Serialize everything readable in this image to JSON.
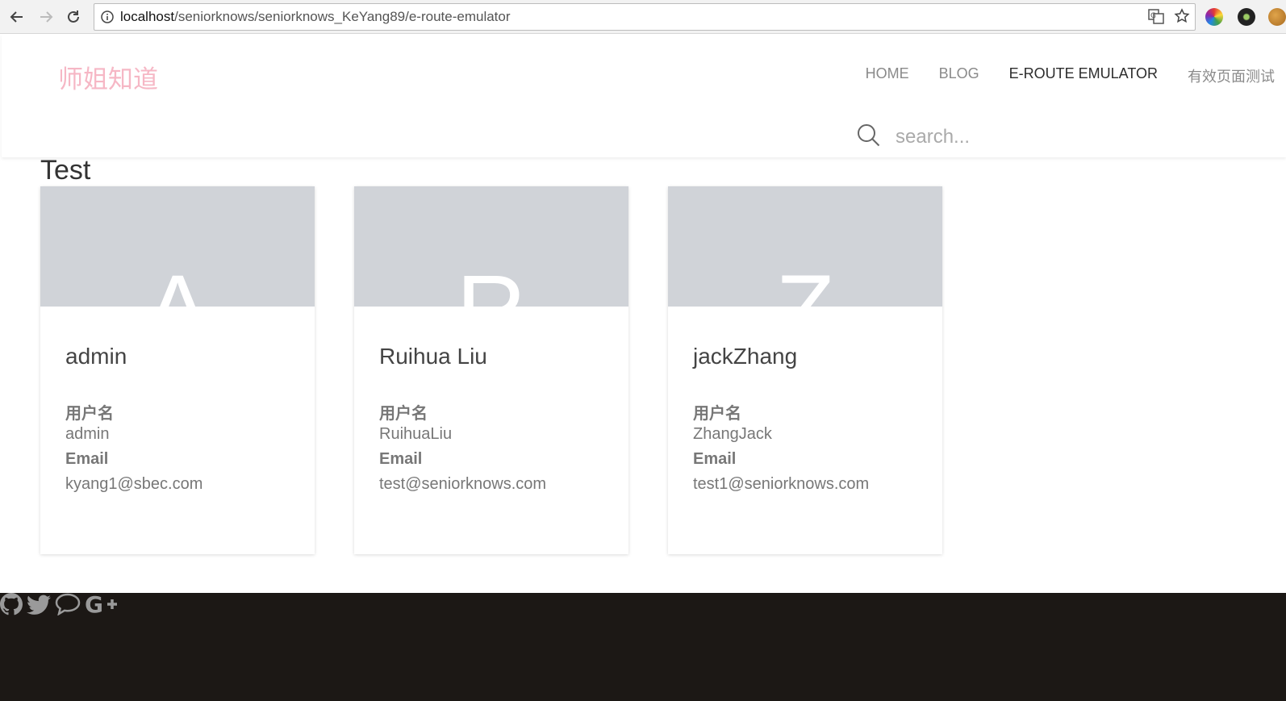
{
  "browser": {
    "url_host": "localhost",
    "url_path": "/seniorknows/seniorknows_KeYang89/e-route-emulator"
  },
  "header": {
    "logo": "师姐知道",
    "nav": [
      {
        "label": "HOME"
      },
      {
        "label": "BLOG"
      },
      {
        "label": "E-ROUTE EMULATOR",
        "active": true
      },
      {
        "label": "有效页面测试"
      }
    ],
    "search_placeholder": "search..."
  },
  "main": {
    "title": "Test",
    "cards": [
      {
        "letter": "A",
        "name": "admin",
        "username_label": "用户名",
        "username": "admin",
        "email_label": "Email",
        "email": "kyang1@sbec.com"
      },
      {
        "letter": "R",
        "name": "Ruihua Liu",
        "username_label": "用户名",
        "username": "RuihuaLiu",
        "email_label": "Email",
        "email": "test@seniorknows.com"
      },
      {
        "letter": "Z",
        "name": "jackZhang",
        "username_label": "用户名",
        "username": "ZhangJack",
        "email_label": "Email",
        "email": "test1@seniorknows.com"
      }
    ]
  },
  "footer": {
    "icons": [
      "github-icon",
      "twitter-icon",
      "comment-icon",
      "google-plus-icon"
    ]
  },
  "colors": {
    "logo": "#f6b7c5",
    "footer_bg": "#1c1815",
    "card_banner": "#d0d3d8"
  }
}
